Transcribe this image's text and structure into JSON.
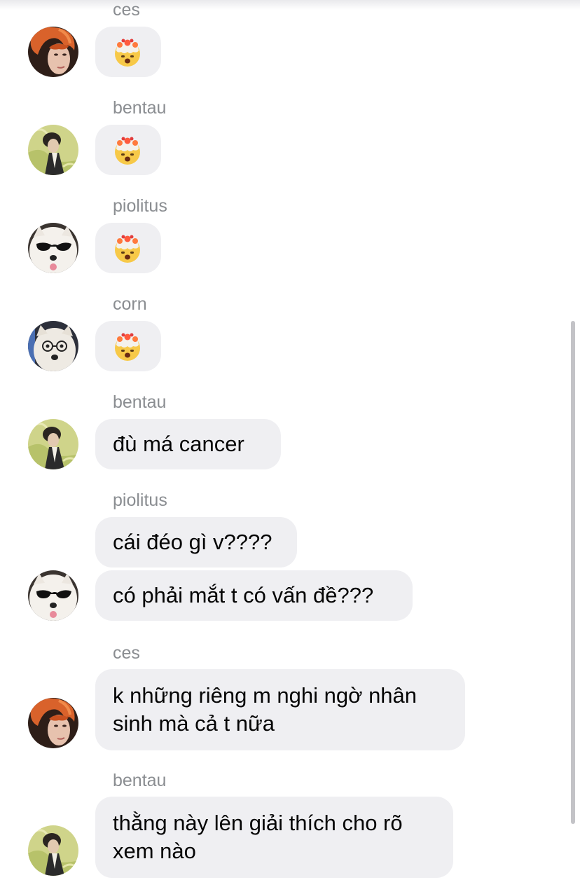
{
  "messages": [
    {
      "sender": "ces",
      "content": "🤯",
      "kind": "emoji",
      "avatar": "orange-hair-avatar"
    },
    {
      "sender": "bentau",
      "content": "🤯",
      "kind": "emoji",
      "avatar": "bentau-avatar"
    },
    {
      "sender": "piolitus",
      "content": "🤯",
      "kind": "emoji",
      "avatar": "dog-sunglasses-avatar"
    },
    {
      "sender": "corn",
      "content": "🤯",
      "kind": "emoji",
      "avatar": "dog-glasses-avatar"
    },
    {
      "sender": "bentau",
      "content": "đù má cancer",
      "kind": "text",
      "avatar": "bentau-avatar"
    },
    {
      "sender": "piolitus",
      "content": "cái đéo gì v????",
      "kind": "text"
    },
    {
      "content": "có phải mắt t có vấn đề???",
      "kind": "text",
      "avatar": "dog-sunglasses-avatar"
    },
    {
      "sender": "ces",
      "content_lines": [
        "k những riêng m nghi ngờ nhân",
        "sinh mà cả t nữa"
      ],
      "kind": "text",
      "avatar": "orange-hair-avatar"
    },
    {
      "sender": "bentau",
      "content_lines": [
        "thằng này lên giải thích cho rõ",
        "xem nào"
      ],
      "kind": "text",
      "avatar": "bentau-avatar"
    }
  ],
  "colors": {
    "bubble_background": "#efeff2",
    "sender_text": "#8a8d91",
    "message_text": "#050505"
  }
}
